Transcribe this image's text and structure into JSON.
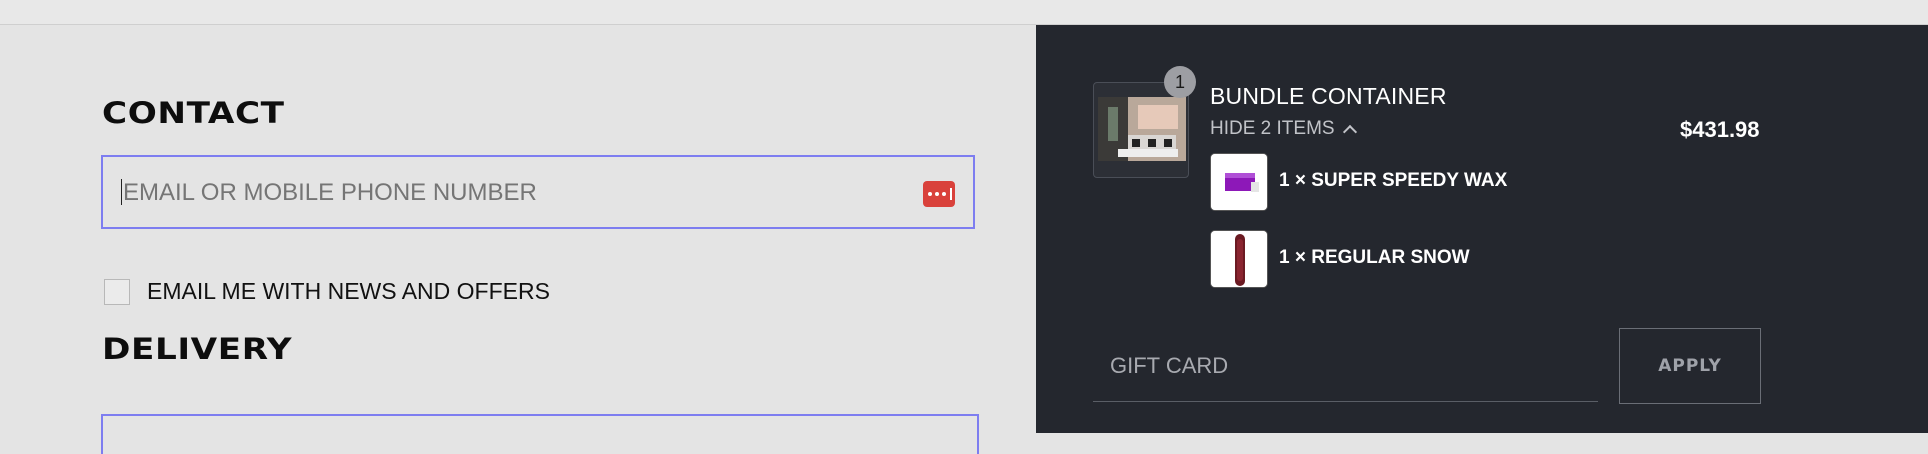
{
  "contact": {
    "heading": "CONTACT",
    "email_placeholder": "EMAIL OR MOBILE PHONE NUMBER",
    "newsletter_label": "EMAIL ME WITH NEWS AND OFFERS"
  },
  "delivery": {
    "heading": "DELIVERY"
  },
  "summary": {
    "item": {
      "quantity": "1",
      "title": "BUNDLE CONTAINER",
      "toggle_label": "HIDE 2 ITEMS",
      "price": "$431.98"
    },
    "sub_items": [
      {
        "label": "1 × SUPER SPEEDY WAX"
      },
      {
        "label": "1 × REGULAR SNOW"
      }
    ],
    "gift_card_placeholder": "GIFT CARD",
    "apply_label": "APPLY"
  },
  "colors": {
    "focus_border": "#7d7df0",
    "summary_bg": "#24272e",
    "password_manager": "#d9413b"
  },
  "icons": {
    "password_manager": "password-manager-icon",
    "toggle": "chevron-up-icon"
  }
}
